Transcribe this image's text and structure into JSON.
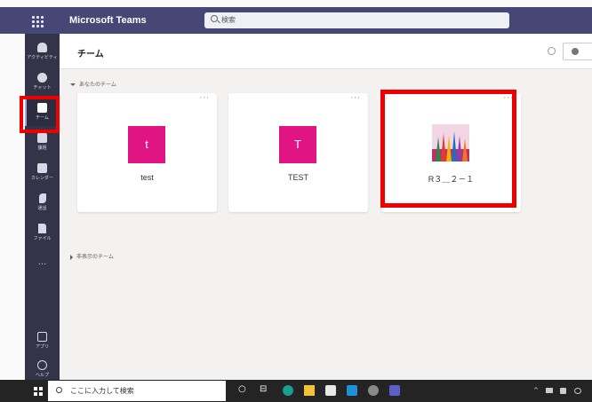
{
  "app": {
    "title": "Microsoft Teams"
  },
  "search": {
    "placeholder": "検索"
  },
  "rail": {
    "items": [
      {
        "label": "アクティビティ",
        "icon": "bell-icon"
      },
      {
        "label": "チャット",
        "icon": "chat-icon"
      },
      {
        "label": "チーム",
        "icon": "teams-icon",
        "active": true
      },
      {
        "label": "課題",
        "icon": "assignments-icon"
      },
      {
        "label": "カレンダー",
        "icon": "calendar-icon"
      },
      {
        "label": "通話",
        "icon": "phone-icon"
      },
      {
        "label": "ファイル",
        "icon": "file-icon"
      }
    ],
    "more": "...",
    "bottom": [
      {
        "label": "アプリ",
        "icon": "apps-icon"
      },
      {
        "label": "ヘルプ",
        "icon": "help-icon"
      }
    ]
  },
  "page": {
    "title": "チーム"
  },
  "sections": {
    "your_teams": "あなたのチーム",
    "hidden_teams": "非表示のチーム"
  },
  "teams": [
    {
      "initial": "t",
      "name": "test",
      "color": "#e01483"
    },
    {
      "initial": "T",
      "name": "TEST",
      "color": "#e01483"
    },
    {
      "initial": "",
      "name": "R３＿２－１",
      "image": "pencils-image"
    }
  ],
  "card_more": "···",
  "taskbar": {
    "search_placeholder": "ここに入力して検索",
    "circle_glyph": "○",
    "taskview_glyph": "⊟",
    "tray_chevron": "^"
  },
  "colors": {
    "teams_header": "#464775",
    "rail": "#33344a",
    "highlight": "#ee0000",
    "avatar": "#e01483"
  }
}
